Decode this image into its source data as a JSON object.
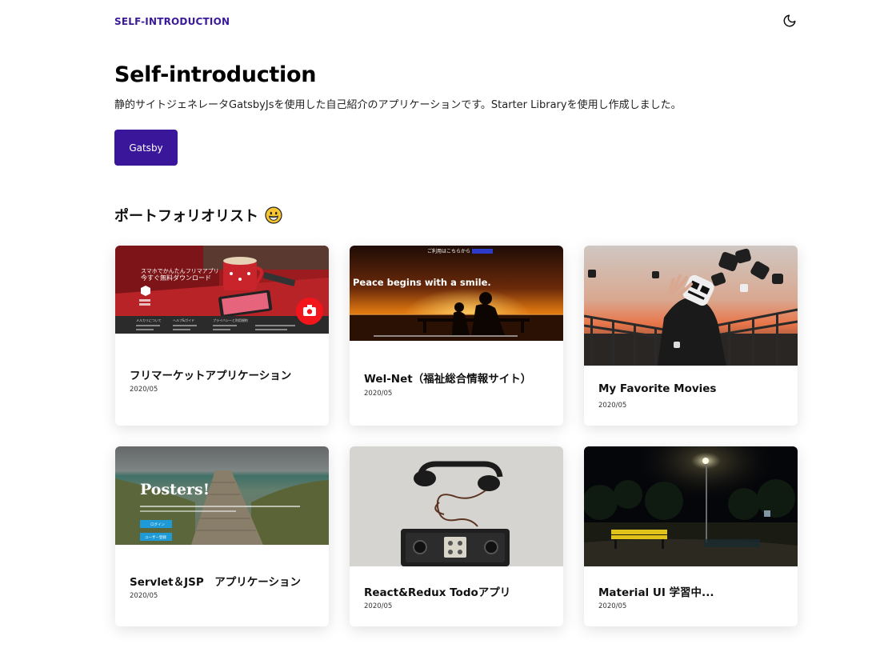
{
  "header": {
    "brand": "SELF-INTRODUCTION",
    "theme_icon": "moon-icon"
  },
  "hero": {
    "title": "Self-introduction",
    "description": "静的サイトジェネレータGatsbyJsを使用した自己紹介のアプリケーションです。Starter Libraryを使用し作成しました。",
    "button_label": "Gatsby"
  },
  "portfolio": {
    "heading": "ポートフォリオリスト",
    "heading_emoji": "grinning-face-emoji",
    "cards": [
      {
        "title": "フリマーケットアプリケーション",
        "date": "2020/05",
        "image": {
          "banner_line1": "スマホでかんたんフリマアプリ",
          "banner_line2": "今すぐ無料ダウンロード",
          "footer_col1": "メルカリについて",
          "footer_col2": "ヘルプ&ガイド",
          "footer_col3": "プライバシーと利用規約",
          "icon": "camera-icon"
        }
      },
      {
        "title": "Wel-Net（福祉総合情報サイト）",
        "date": "2020/05",
        "image": {
          "top_text": "ご利用はこちらから",
          "headline": "Peace begins with a smile."
        }
      },
      {
        "title": "My Favorite Movies",
        "date": "2020/05",
        "image": {}
      },
      {
        "title": "Servlet＆JSP　アプリケーション",
        "date": "2020/05",
        "image": {
          "headline": "Posters!",
          "btn1": "ログイン",
          "btn2": "ユーザー登録"
        }
      },
      {
        "title": "React&Redux Todoアプリ",
        "date": "2020/05",
        "image": {}
      },
      {
        "title": "Material UI 学習中...",
        "date": "2020/05",
        "image": {}
      }
    ]
  },
  "colors": {
    "brand": "#3a1a9a",
    "button": "#3a169b"
  }
}
